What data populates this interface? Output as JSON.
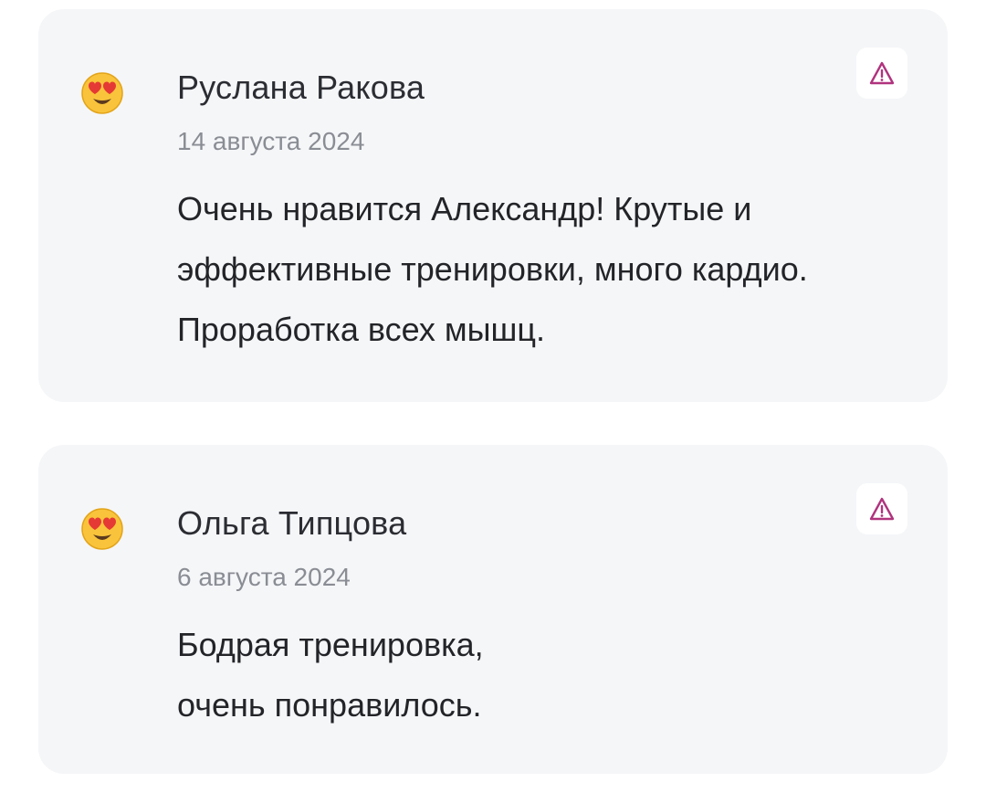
{
  "reviews": [
    {
      "author": "Руслана Ракова",
      "date": "14 августа 2024",
      "text": "Очень нравится Александр! Крутые и эффективные тренировки, много кардио. Проработка всех мышц.",
      "avatar_icon": "heart-eyes-emoji-icon",
      "report_icon": "warning-triangle-icon"
    },
    {
      "author": "Ольга Типцова",
      "date": "6 августа 2024",
      "text": "Бодрая тренировка, очень понравилось.",
      "avatar_icon": "heart-eyes-emoji-icon",
      "report_icon": "warning-triangle-icon"
    }
  ],
  "colors": {
    "card_background": "#f5f6f8",
    "report_icon": "#b0337e",
    "author_text": "#2b2d33",
    "date_text": "#8a8d94"
  }
}
